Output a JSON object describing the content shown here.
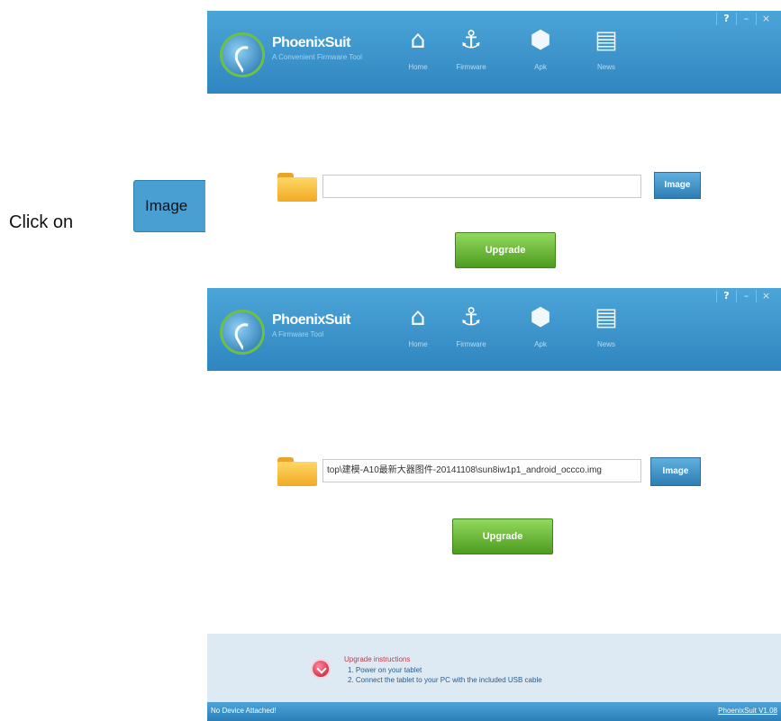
{
  "instruction": {
    "text": "Click on",
    "button_label": "Image"
  },
  "windows": [
    {
      "logo": {
        "title": "PhoenixSuit",
        "subtitle": "A Convenient Firmware Tool"
      },
      "nav": [
        {
          "label": "Home",
          "icon": "home-icon"
        },
        {
          "label": "Firmware",
          "icon": "anchor-icon"
        },
        {
          "label": "Apk",
          "icon": "cube-icon"
        },
        {
          "label": "News",
          "icon": "news-icon"
        }
      ],
      "controls": {
        "help": "?",
        "minimize": "–",
        "close": "×"
      },
      "path_value": "",
      "image_button": "Image",
      "upgrade_button": "Upgrade"
    },
    {
      "logo": {
        "title": "PhoenixSuit",
        "subtitle": "A Firmware Tool"
      },
      "nav": [
        {
          "label": "Home",
          "icon": "home-icon"
        },
        {
          "label": "Firmware",
          "icon": "anchor-icon"
        },
        {
          "label": "Apk",
          "icon": "cube-icon"
        },
        {
          "label": "News",
          "icon": "news-icon"
        }
      ],
      "controls": {
        "help": "?",
        "minimize": "–",
        "close": "×"
      },
      "path_value": "top\\建模-A10最新大器图件-20141108\\sun8iw1p1_android_occco.img",
      "image_button": "Image",
      "upgrade_button": "Upgrade",
      "instructions": {
        "title": "Upgrade instructions",
        "lines": [
          "1. Power on your tablet",
          "2. Connect the tablet to your PC with the included USB cable"
        ]
      },
      "status": {
        "left": "No Device Attached!",
        "right": "PhoenixSuit V1.08"
      }
    }
  ],
  "colors": {
    "header_blue": "#2f86c0",
    "upgrade_green": "#4c9c1f",
    "status_blue": "#2b7fb8"
  }
}
